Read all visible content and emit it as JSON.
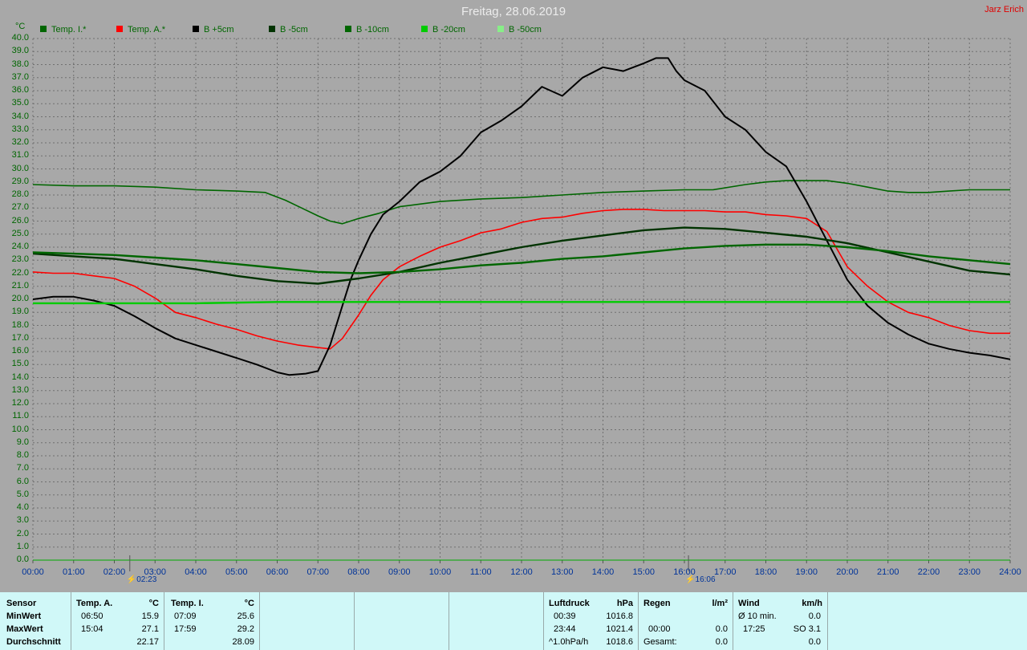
{
  "title": "Freitag, 28.06.2019",
  "author": "Jarz Erich",
  "colors": {
    "background": "#a8a8a8",
    "grid": "#707070",
    "axis_text": "#006600",
    "time_text": "#003399"
  },
  "legend": [
    {
      "label": "Temp. I.*",
      "color": "#006600"
    },
    {
      "label": "Temp. A.*",
      "color": "#ff0000"
    },
    {
      "label": "B +5cm",
      "color": "#000000"
    },
    {
      "label": "B -5cm",
      "color": "#003300"
    },
    {
      "label": "B -10cm",
      "color": "#006600"
    },
    {
      "label": "B -20cm",
      "color": "#00cc00"
    },
    {
      "label": "B -50cm",
      "color": "#88ee88"
    }
  ],
  "chart_data": {
    "type": "line",
    "title": "Freitag, 28.06.2019",
    "ylabel": "°C",
    "ylim": [
      0,
      40
    ],
    "ystep": 1,
    "xlim": [
      0,
      24
    ],
    "x_ticks": [
      "00:00",
      "01:00",
      "02:00",
      "03:00",
      "04:00",
      "05:00",
      "06:00",
      "07:00",
      "08:00",
      "09:00",
      "10:00",
      "11:00",
      "12:00",
      "13:00",
      "14:00",
      "15:00",
      "16:00",
      "17:00",
      "18:00",
      "19:00",
      "20:00",
      "21:00",
      "22:00",
      "23:00",
      "24:00"
    ],
    "grid": true,
    "legend_position": "top-left",
    "markers": [
      {
        "x": 2.38,
        "label": "02:23"
      },
      {
        "x": 16.1,
        "label": "16:06"
      }
    ],
    "series": [
      {
        "name": "Temp. I.*",
        "color": "#006600",
        "width": 1.6,
        "x": [
          0,
          1,
          2,
          3,
          4,
          5,
          5.7,
          6.2,
          6.6,
          7,
          7.3,
          7.6,
          8,
          8.5,
          9,
          10,
          11,
          12,
          13,
          14,
          15,
          16,
          16.7,
          17.5,
          18,
          18.5,
          19,
          19.5,
          20,
          20.5,
          21,
          21.5,
          22,
          22.5,
          23,
          24
        ],
        "y": [
          28.8,
          28.7,
          28.7,
          28.6,
          28.4,
          28.3,
          28.2,
          27.6,
          27.0,
          26.4,
          26.0,
          25.8,
          26.2,
          26.6,
          27.1,
          27.5,
          27.7,
          27.8,
          28.0,
          28.2,
          28.3,
          28.4,
          28.4,
          28.8,
          29.0,
          29.1,
          29.1,
          29.1,
          28.9,
          28.6,
          28.3,
          28.2,
          28.2,
          28.3,
          28.4,
          28.4
        ]
      },
      {
        "name": "Temp. A.*",
        "color": "#ff0000",
        "width": 1.6,
        "x": [
          0,
          0.5,
          1,
          1.5,
          2,
          2.5,
          3,
          3.5,
          4,
          4.5,
          5,
          5.5,
          6,
          6.5,
          7,
          7.3,
          7.6,
          8,
          8.3,
          8.6,
          9,
          9.5,
          10,
          10.5,
          11,
          11.5,
          12,
          12.5,
          13,
          13.5,
          14,
          14.5,
          15,
          15.5,
          16,
          16.5,
          17,
          17.5,
          18,
          18.5,
          19,
          19.5,
          20,
          20.5,
          21,
          21.5,
          22,
          22.5,
          23,
          23.5,
          24
        ],
        "y": [
          22.1,
          22.0,
          22.0,
          21.8,
          21.6,
          21.0,
          20.1,
          19.0,
          18.6,
          18.1,
          17.7,
          17.2,
          16.8,
          16.5,
          16.3,
          16.2,
          17.0,
          18.8,
          20.3,
          21.5,
          22.5,
          23.3,
          24.0,
          24.5,
          25.1,
          25.4,
          25.9,
          26.2,
          26.3,
          26.6,
          26.8,
          26.9,
          26.9,
          26.8,
          26.8,
          26.8,
          26.7,
          26.7,
          26.5,
          26.4,
          26.2,
          25.2,
          22.5,
          21.0,
          19.8,
          19.0,
          18.6,
          18.0,
          17.6,
          17.4,
          17.4
        ]
      },
      {
        "name": "B +5cm",
        "color": "#000000",
        "width": 2.0,
        "x": [
          0,
          0.5,
          1,
          1.5,
          2,
          2.5,
          3,
          3.5,
          4,
          4.5,
          5,
          5.5,
          6,
          6.3,
          6.7,
          7,
          7.3,
          7.6,
          7.8,
          8,
          8.3,
          8.6,
          9,
          9.5,
          10,
          10.5,
          11,
          11.5,
          12,
          12.5,
          13,
          13.5,
          14,
          14.5,
          15,
          15.3,
          15.6,
          15.8,
          16,
          16.5,
          17,
          17.5,
          18,
          18.5,
          19,
          19.5,
          20,
          20.5,
          21,
          21.5,
          22,
          22.5,
          23,
          23.5,
          24
        ],
        "y": [
          20.0,
          20.2,
          20.2,
          19.9,
          19.5,
          18.7,
          17.8,
          17.0,
          16.5,
          16.0,
          15.5,
          15.0,
          14.4,
          14.2,
          14.3,
          14.5,
          16.5,
          19.5,
          21.5,
          23.0,
          25.0,
          26.5,
          27.5,
          29.0,
          29.8,
          31.0,
          32.8,
          33.7,
          34.8,
          36.3,
          35.6,
          37.0,
          37.8,
          37.5,
          38.1,
          38.5,
          38.5,
          37.5,
          36.8,
          36.0,
          34.0,
          33.0,
          31.3,
          30.2,
          27.5,
          24.5,
          21.5,
          19.5,
          18.2,
          17.3,
          16.6,
          16.2,
          15.9,
          15.7,
          15.4
        ]
      },
      {
        "name": "B -5cm",
        "color": "#003300",
        "width": 2.4,
        "x": [
          0,
          1,
          2,
          3,
          4,
          5,
          6,
          7,
          8,
          9,
          10,
          11,
          12,
          13,
          14,
          15,
          16,
          17,
          18,
          19,
          20,
          21,
          22,
          23,
          24
        ],
        "y": [
          23.5,
          23.3,
          23.1,
          22.7,
          22.3,
          21.8,
          21.4,
          21.2,
          21.6,
          22.1,
          22.8,
          23.4,
          24.0,
          24.5,
          24.9,
          25.3,
          25.5,
          25.4,
          25.1,
          24.8,
          24.3,
          23.6,
          22.9,
          22.2,
          21.9
        ]
      },
      {
        "name": "B -10cm",
        "color": "#006600",
        "width": 2.4,
        "x": [
          0,
          1,
          2,
          3,
          4,
          5,
          6,
          7,
          8,
          9,
          10,
          11,
          12,
          13,
          14,
          15,
          16,
          17,
          18,
          19,
          20,
          21,
          22,
          23,
          24
        ],
        "y": [
          23.6,
          23.5,
          23.4,
          23.2,
          23.0,
          22.7,
          22.4,
          22.1,
          22.0,
          22.1,
          22.3,
          22.6,
          22.8,
          23.1,
          23.3,
          23.6,
          23.9,
          24.1,
          24.2,
          24.2,
          24.0,
          23.7,
          23.3,
          23.0,
          22.7
        ]
      },
      {
        "name": "B -20cm",
        "color": "#00cc00",
        "width": 2.4,
        "x": [
          0,
          2,
          4,
          6,
          8,
          10,
          12,
          14,
          16,
          18,
          20,
          22,
          24
        ],
        "y": [
          19.7,
          19.7,
          19.7,
          19.8,
          19.8,
          19.8,
          19.8,
          19.8,
          19.8,
          19.8,
          19.8,
          19.8,
          19.8
        ]
      }
    ]
  },
  "stats": {
    "sensor_header": "Sensor",
    "rows": [
      "MinWert",
      "MaxWert",
      "Durchschnitt"
    ],
    "temp_a": {
      "title": "Temp. A.",
      "unit": "°C",
      "min_time": "06:50",
      "min": "15.9",
      "max_time": "15:04",
      "max": "27.1",
      "avg": "22.17"
    },
    "temp_i": {
      "title": "Temp. I.",
      "unit": "°C",
      "min_time": "07:09",
      "min": "25.6",
      "max_time": "17:59",
      "max": "29.2",
      "avg": "28.09"
    },
    "pressure": {
      "title": "Luftdruck",
      "unit": "hPa",
      "min_time": "00:39",
      "min": "1016.8",
      "max_time": "23:44",
      "max": "1021.4",
      "avg_label": "^1.0hPa/h",
      "avg": "1018.6"
    },
    "rain": {
      "title": "Regen",
      "unit": "l/m²",
      "time": "00:00",
      "value": "0.0",
      "total_label": "Gesamt:",
      "total": "0.0",
      "top": "0.0"
    },
    "wind": {
      "title": "Wind",
      "unit": "km/h",
      "avg_label": "Ø 10 min.",
      "avg": "0.0",
      "time": "17:25",
      "max": "SO 3.1",
      "bottom": "0.0"
    }
  }
}
